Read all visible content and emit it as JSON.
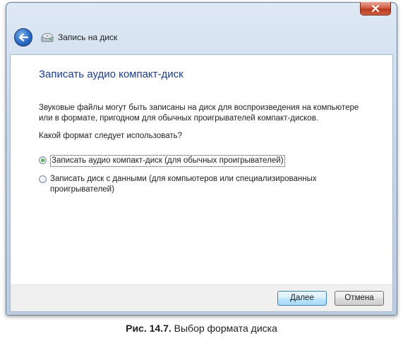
{
  "window": {
    "nav_title": "Запись на диск",
    "close_icon": "close-icon",
    "back_icon": "back-arrow-icon"
  },
  "content": {
    "heading": "Записать аудио компакт-диск",
    "description": "Звуковые файлы могут быть записаны на диск для воспроизведения на компьютере или в формате, пригодном для обычных проигрывателей компакт-дисков.",
    "question": "Какой формат следует использовать?",
    "options": [
      {
        "label": "Записать аудио компакт-диск (для обычных проигрывателей)",
        "checked": true
      },
      {
        "label": "Записать диск с данными (для компьютеров или специализированных проигрывателей)",
        "checked": false
      }
    ]
  },
  "footer": {
    "next_label_first": "Д",
    "next_label_rest": "алее",
    "cancel_label": "Отмена"
  },
  "caption": {
    "number": "Рис. 14.7.",
    "text": " Выбор формата диска"
  },
  "colors": {
    "heading": "#1a3d8f",
    "close_red": "#c0412a"
  }
}
